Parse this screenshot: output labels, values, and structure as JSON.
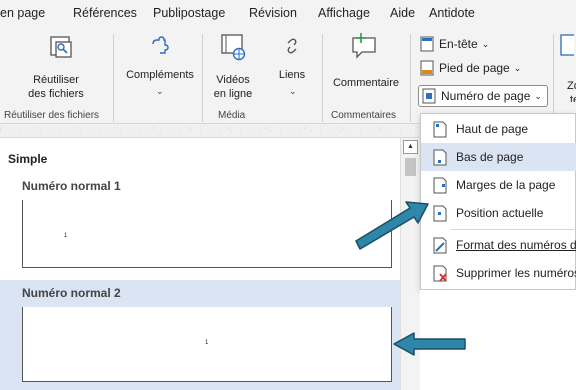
{
  "menu": {
    "tabs": [
      "en page",
      "Références",
      "Publipostage",
      "Révision",
      "Affichage",
      "Aide",
      "Antidote"
    ]
  },
  "ribbon": {
    "reuse": {
      "line1": "Réutiliser",
      "line2": "des fichiers"
    },
    "complements": {
      "label": "Compléments"
    },
    "videos": {
      "line1": "Vidéos",
      "line2": "en ligne"
    },
    "links": {
      "label": "Liens"
    },
    "comment": {
      "label": "Commentaire"
    },
    "header": {
      "label": "En-tête"
    },
    "footer": {
      "label": "Pied de page"
    },
    "page_number": {
      "label": "Numéro de page"
    },
    "cut_text": {
      "line1": "Zo",
      "line2": "te"
    },
    "groups": {
      "reuse": "Réutiliser des fichiers",
      "media": "Média",
      "comments": "Commentaires"
    }
  },
  "gallery": {
    "section": "Simple",
    "items": [
      {
        "label": "Numéro normal 1",
        "number": "1"
      },
      {
        "label": "Numéro normal 2",
        "number": "1"
      }
    ]
  },
  "dropdown": {
    "items": [
      {
        "label": "Haut de page"
      },
      {
        "label": "Bas de page"
      },
      {
        "label": "Marges de la page"
      },
      {
        "label": "Position actuelle"
      },
      {
        "label": "Format des numéros de"
      },
      {
        "label": "Supprimer les numéros"
      }
    ]
  },
  "colors": {
    "highlight": "#dbe4f3",
    "arrow_fill": "#2e86a8",
    "arrow_stroke": "#1c4e66",
    "icon_blue": "#2b6fbf"
  }
}
